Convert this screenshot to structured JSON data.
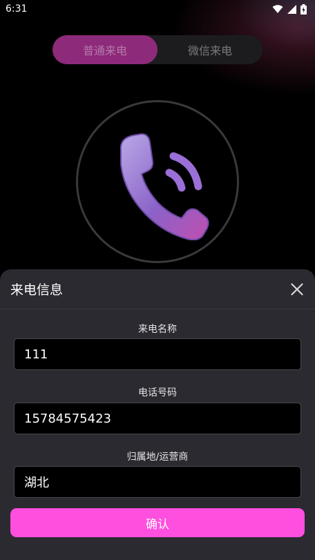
{
  "status_bar": {
    "time": "6:31"
  },
  "tabs": [
    {
      "label": "普通来电",
      "active": true
    },
    {
      "label": "微信来电",
      "active": false
    }
  ],
  "sheet": {
    "title": "来电信息",
    "fields": [
      {
        "label": "来电名称",
        "value": "111"
      },
      {
        "label": "电话号码",
        "value": "15784575423"
      },
      {
        "label": "归属地/运营商",
        "value": "湖北"
      }
    ],
    "confirm_label": "确认"
  },
  "colors": {
    "accent": "#ff4fdf",
    "active_tab": "#8e2a7a",
    "sheet_bg": "#2b2a30"
  },
  "icons": [
    "wifi-icon",
    "signal-icon",
    "battery-icon",
    "phone-call-icon",
    "close-icon"
  ]
}
